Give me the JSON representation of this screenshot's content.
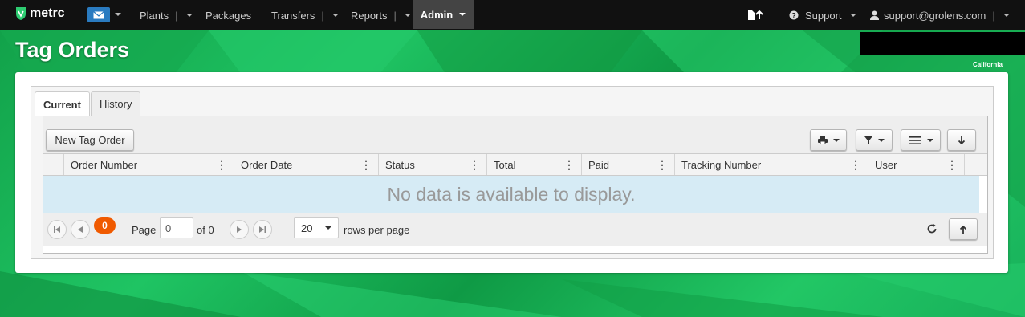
{
  "navbar": {
    "brand": "metrc",
    "items": [
      {
        "label": "Plants",
        "has_dropdown": true
      },
      {
        "label": "Packages",
        "has_dropdown": false
      },
      {
        "label": "Transfers",
        "has_dropdown": true
      },
      {
        "label": "Reports",
        "has_dropdown": true
      },
      {
        "label": "Admin",
        "has_dropdown": true,
        "active": true
      }
    ],
    "support_label": "Support",
    "user_email": "support@grolens.com"
  },
  "page": {
    "title": "Tag Orders",
    "region": "California"
  },
  "tabs": [
    {
      "label": "Current",
      "active": true
    },
    {
      "label": "History",
      "active": false
    }
  ],
  "toolbar": {
    "new_order_label": "New Tag Order"
  },
  "grid": {
    "columns": [
      "Order Number",
      "Order Date",
      "Status",
      "Total",
      "Paid",
      "Tracking Number",
      "User"
    ],
    "empty_message": "No data is available to display."
  },
  "pager": {
    "badge_count": "0",
    "page_label": "Page",
    "page_value": "0",
    "of_label": "of 0",
    "rows_value": "20",
    "rows_label": "rows per page"
  },
  "colors": {
    "navbar_bg": "#111111",
    "accent_green": "#1db954",
    "admin_active_bg": "#444444",
    "mail_blue": "#2a7bc0",
    "badge_orange": "#f05a00",
    "nodata_bg": "#d6ebf5"
  }
}
